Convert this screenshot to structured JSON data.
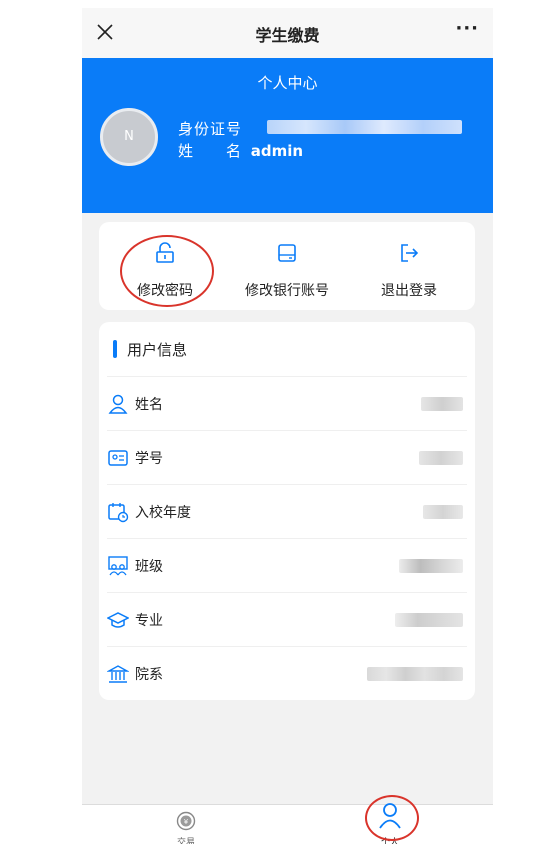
{
  "topbar": {
    "title": "学生缴费",
    "more": "···"
  },
  "header": {
    "title": "个人中心",
    "avatar_letter": "N",
    "id_label": "身份证号",
    "name_label": "姓　　名",
    "name_value": "admin"
  },
  "actions": [
    {
      "label": "修改密码",
      "icon": "unlock-icon"
    },
    {
      "label": "修改银行账号",
      "icon": "bank-card-icon"
    },
    {
      "label": "退出登录",
      "icon": "logout-icon"
    }
  ],
  "user_info": {
    "section_title": "用户信息",
    "rows": [
      {
        "label": "姓名",
        "icon": "person-icon"
      },
      {
        "label": "学号",
        "icon": "id-card-icon"
      },
      {
        "label": "入校年度",
        "icon": "calendar-clock-icon"
      },
      {
        "label": "班级",
        "icon": "class-group-icon"
      },
      {
        "label": "专业",
        "icon": "graduation-cap-icon"
      },
      {
        "label": "院系",
        "icon": "institution-icon"
      }
    ]
  },
  "tabbar": {
    "tabs": [
      {
        "label": "交易",
        "icon": "coin-icon"
      },
      {
        "label": "个人",
        "icon": "person-icon",
        "active": true
      }
    ]
  },
  "colors": {
    "accent": "#0a7cf8",
    "annotation": "#d9342b"
  }
}
